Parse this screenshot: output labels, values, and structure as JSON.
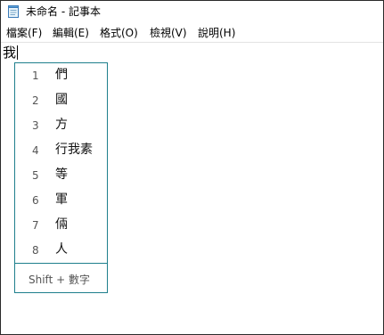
{
  "window": {
    "title": "未命名 - 記事本",
    "icon": "notepad-icon"
  },
  "menu": {
    "items": [
      {
        "label": "檔案(F)"
      },
      {
        "label": "編輯(E)"
      },
      {
        "label": "格式(O)"
      },
      {
        "label": "檢視(V)"
      },
      {
        "label": "說明(H)"
      }
    ]
  },
  "editor": {
    "text": "我"
  },
  "ime": {
    "candidates": [
      {
        "num": "1",
        "text": "們"
      },
      {
        "num": "2",
        "text": "國"
      },
      {
        "num": "3",
        "text": "方"
      },
      {
        "num": "4",
        "text": "行我素"
      },
      {
        "num": "5",
        "text": "等"
      },
      {
        "num": "6",
        "text": "軍"
      },
      {
        "num": "7",
        "text": "倆"
      },
      {
        "num": "8",
        "text": "人"
      }
    ],
    "hint": "Shift + 數字"
  },
  "colors": {
    "accent": "#1e7f8c",
    "border": "#2a2a2a"
  }
}
